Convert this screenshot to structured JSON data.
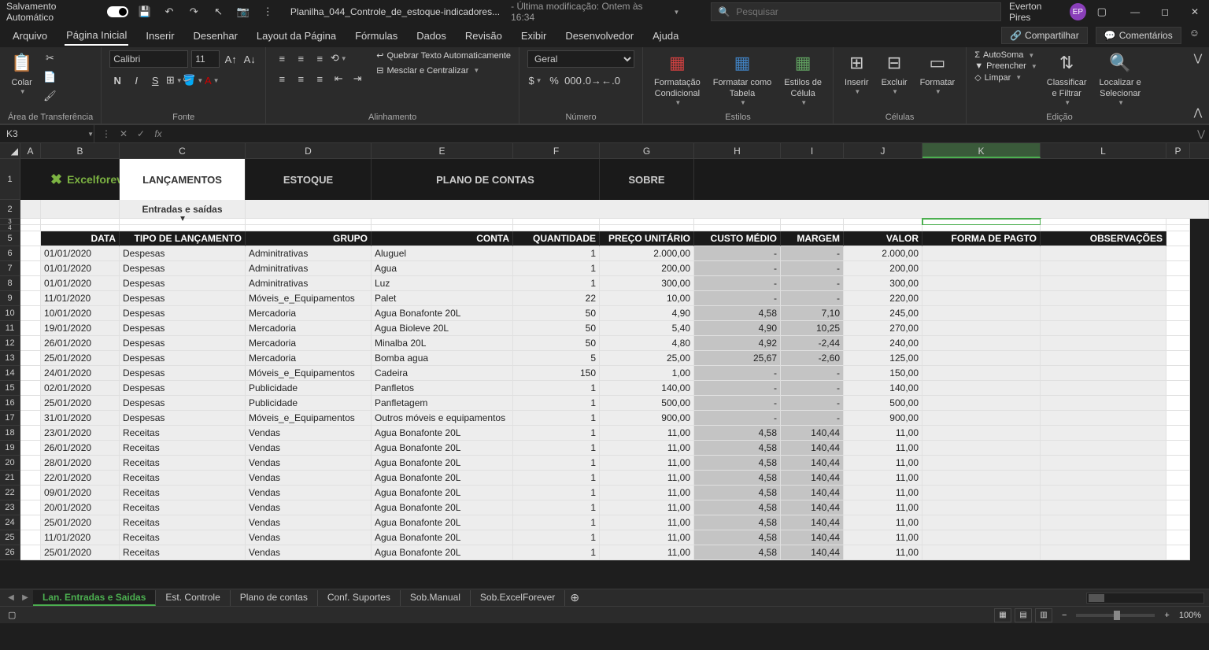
{
  "title_bar": {
    "autosave_label": "Salvamento Automático",
    "file_name": "Planilha_044_Controle_de_estoque-indicadores...",
    "modified": "- Última modificação: Ontem às 16:34",
    "search_placeholder": "Pesquisar",
    "user_name": "Everton Pires",
    "user_initials": "EP"
  },
  "menu": {
    "tabs": [
      "Arquivo",
      "Página Inicial",
      "Inserir",
      "Desenhar",
      "Layout da Página",
      "Fórmulas",
      "Dados",
      "Revisão",
      "Exibir",
      "Desenvolvedor",
      "Ajuda"
    ],
    "active": 1,
    "share": "Compartilhar",
    "comments": "Comentários"
  },
  "ribbon": {
    "clipboard_label": "Colar",
    "clipboard_group": "Área de Transferência",
    "font_name": "Calibri",
    "font_size": "11",
    "font_group": "Fonte",
    "wrap": "Quebrar Texto Automaticamente",
    "merge": "Mesclar e Centralizar",
    "align_group": "Alinhamento",
    "number_format": "Geral",
    "number_group": "Número",
    "cond_fmt": "Formatação\nCondicional",
    "table_fmt": "Formatar como\nTabela",
    "cell_styles": "Estilos de\nCélula",
    "styles_group": "Estilos",
    "insert": "Inserir",
    "delete": "Excluir",
    "format": "Formatar",
    "cells_group": "Células",
    "autosum": "AutoSoma",
    "fill": "Preencher",
    "clear": "Limpar",
    "sort": "Classificar\ne Filtrar",
    "find": "Localizar e\nSelecionar",
    "edit_group": "Edição"
  },
  "formula_bar": {
    "cell_ref": "K3",
    "formula": ""
  },
  "columns": {
    "A": 26,
    "B": 100,
    "C": 160,
    "D": 160,
    "E": 180,
    "F": 110,
    "G": 120,
    "H": 110,
    "I": 80,
    "J": 100,
    "K": 150,
    "L": 160,
    "P": 30
  },
  "col_labels": [
    "A",
    "B",
    "C",
    "D",
    "E",
    "F",
    "G",
    "H",
    "I",
    "J",
    "K",
    "L",
    "P"
  ],
  "nav": {
    "logo": "Excelforever",
    "tabs": [
      "LANÇAMENTOS",
      "ESTOQUE",
      "PLANO DE CONTAS",
      "SOBRE"
    ],
    "subtitle": "Entradas e saídas"
  },
  "table": {
    "headers": [
      "DATA",
      "TIPO DE LANÇAMENTO",
      "GRUPO",
      "CONTA",
      "QUANTIDADE",
      "PREÇO UNITÁRIO",
      "CUSTO MÉDIO",
      "MARGEM",
      "VALOR",
      "FORMA DE PAGTO",
      "OBSERVAÇÕES"
    ],
    "rows": [
      [
        "01/01/2020",
        "Despesas",
        "Adminitrativas",
        "Aluguel",
        "1",
        "2.000,00",
        "-",
        "-",
        "2.000,00",
        "",
        ""
      ],
      [
        "01/01/2020",
        "Despesas",
        "Adminitrativas",
        "Agua",
        "1",
        "200,00",
        "-",
        "-",
        "200,00",
        "",
        ""
      ],
      [
        "01/01/2020",
        "Despesas",
        "Adminitrativas",
        "Luz",
        "1",
        "300,00",
        "-",
        "-",
        "300,00",
        "",
        ""
      ],
      [
        "11/01/2020",
        "Despesas",
        "Móveis_e_Equipamentos",
        "Palet",
        "22",
        "10,00",
        "-",
        "-",
        "220,00",
        "",
        ""
      ],
      [
        "10/01/2020",
        "Despesas",
        "Mercadoria",
        "Agua Bonafonte 20L",
        "50",
        "4,90",
        "4,58",
        "7,10",
        "245,00",
        "",
        ""
      ],
      [
        "19/01/2020",
        "Despesas",
        "Mercadoria",
        "Agua Bioleve 20L",
        "50",
        "5,40",
        "4,90",
        "10,25",
        "270,00",
        "",
        ""
      ],
      [
        "26/01/2020",
        "Despesas",
        "Mercadoria",
        "Minalba 20L",
        "50",
        "4,80",
        "4,92",
        "-2,44",
        "240,00",
        "",
        ""
      ],
      [
        "25/01/2020",
        "Despesas",
        "Mercadoria",
        "Bomba agua",
        "5",
        "25,00",
        "25,67",
        "-2,60",
        "125,00",
        "",
        ""
      ],
      [
        "24/01/2020",
        "Despesas",
        "Móveis_e_Equipamentos",
        "Cadeira",
        "150",
        "1,00",
        "-",
        "-",
        "150,00",
        "",
        ""
      ],
      [
        "02/01/2020",
        "Despesas",
        "Publicidade",
        "Panfletos",
        "1",
        "140,00",
        "-",
        "-",
        "140,00",
        "",
        ""
      ],
      [
        "25/01/2020",
        "Despesas",
        "Publicidade",
        "Panfletagem",
        "1",
        "500,00",
        "-",
        "-",
        "500,00",
        "",
        ""
      ],
      [
        "31/01/2020",
        "Despesas",
        "Móveis_e_Equipamentos",
        "Outros móveis e equipamentos",
        "1",
        "900,00",
        "-",
        "-",
        "900,00",
        "",
        ""
      ],
      [
        "23/01/2020",
        "Receitas",
        "Vendas",
        "Agua Bonafonte 20L",
        "1",
        "11,00",
        "4,58",
        "140,44",
        "11,00",
        "",
        ""
      ],
      [
        "26/01/2020",
        "Receitas",
        "Vendas",
        "Agua Bonafonte 20L",
        "1",
        "11,00",
        "4,58",
        "140,44",
        "11,00",
        "",
        ""
      ],
      [
        "28/01/2020",
        "Receitas",
        "Vendas",
        "Agua Bonafonte 20L",
        "1",
        "11,00",
        "4,58",
        "140,44",
        "11,00",
        "",
        ""
      ],
      [
        "22/01/2020",
        "Receitas",
        "Vendas",
        "Agua Bonafonte 20L",
        "1",
        "11,00",
        "4,58",
        "140,44",
        "11,00",
        "",
        ""
      ],
      [
        "09/01/2020",
        "Receitas",
        "Vendas",
        "Agua Bonafonte 20L",
        "1",
        "11,00",
        "4,58",
        "140,44",
        "11,00",
        "",
        ""
      ],
      [
        "20/01/2020",
        "Receitas",
        "Vendas",
        "Agua Bonafonte 20L",
        "1",
        "11,00",
        "4,58",
        "140,44",
        "11,00",
        "",
        ""
      ],
      [
        "25/01/2020",
        "Receitas",
        "Vendas",
        "Agua Bonafonte 20L",
        "1",
        "11,00",
        "4,58",
        "140,44",
        "11,00",
        "",
        ""
      ],
      [
        "11/01/2020",
        "Receitas",
        "Vendas",
        "Agua Bonafonte 20L",
        "1",
        "11,00",
        "4,58",
        "140,44",
        "11,00",
        "",
        ""
      ],
      [
        "25/01/2020",
        "Receitas",
        "Vendas",
        "Agua Bonafonte 20L",
        "1",
        "11,00",
        "4,58",
        "140,44",
        "11,00",
        "",
        ""
      ]
    ],
    "row_start": 6
  },
  "sheet_tabs": {
    "tabs": [
      "Lan. Entradas e Saidas",
      "Est. Controle",
      "Plano de contas",
      "Conf. Suportes",
      "Sob.Manual",
      "Sob.ExcelForever"
    ],
    "active": 0
  },
  "status": {
    "zoom": "100%"
  }
}
